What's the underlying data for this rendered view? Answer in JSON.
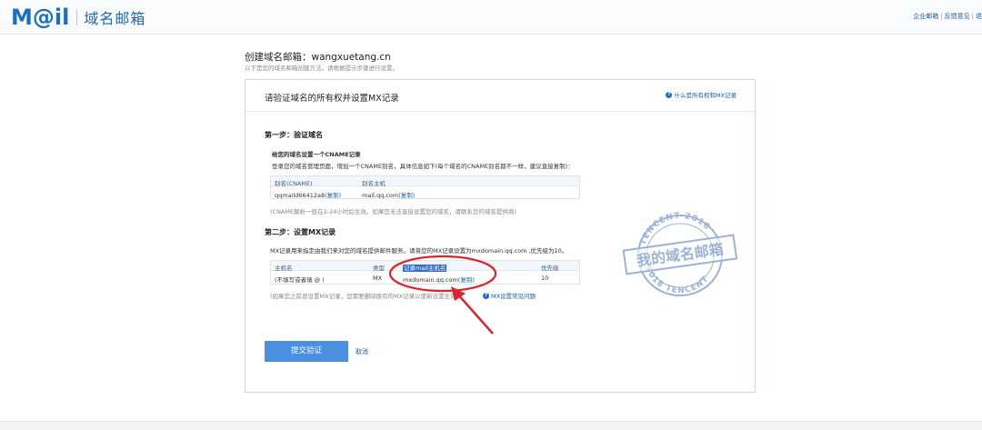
{
  "topbar": {
    "logo_mail": "M@il",
    "logo_text": "域名邮箱",
    "links": [
      "企业邮箱",
      "反馈意见",
      "退"
    ]
  },
  "header": {
    "title": "创建域名邮箱：wangxuetang.cn",
    "subtitle": "以下是您的域名邮箱创建方法。请根据提示步骤进行设置。"
  },
  "panel": {
    "title": "请验证域名的所有权并设置MX记录",
    "help_link": "什么是所有权和MX记录"
  },
  "step1": {
    "title": "第一步：验证域名",
    "subtitle": "给您的域名设置一个CNAME记录",
    "desc": "登录您的域名管理页面，增加一个CNAME别名，具体信息如下(每个域名的CNAME别名都不一样，建议直接复制)：",
    "table": {
      "headers": [
        "别名(CNAME)",
        "别名主机"
      ],
      "row": {
        "alias": "qqmaild66412a8",
        "host": "mail.qq.com"
      },
      "copy_label": "(复制)"
    },
    "note": "(CNAME解析一般在2-24小时后生效。如果您无法直接设置您的域名，请联系您的域名提供商)"
  },
  "step2": {
    "title": "第二步：设置MX记录",
    "desc": "MX记录用来指定由我们来对您的域名提供邮件服务。请将您的MX记录设置为mxdomain.qq.com ,优先级为10。",
    "table": {
      "headers": [
        "主机名",
        "类型",
        "记录mail主机名",
        "优先级"
      ],
      "row": {
        "host": "(不填写或者填 @ )",
        "type": "MX",
        "value": "mxdomain.qq.com",
        "priority": "10"
      },
      "copy_label": "(复制)"
    },
    "note": "(如果您之前曾设置MX记录，您需要删除原有的MX记录以使新设置生效)",
    "faq_link": "MX设置常见问题"
  },
  "actions": {
    "submit": "提交验证",
    "cancel": "取消"
  },
  "stamp": {
    "main": "我的域名邮箱",
    "ring_top": "TENCENT 2018",
    "ring_bottom": "2018 TENCENT"
  },
  "colors": {
    "brand": "#1a6fc4",
    "link": "#1a5fa8",
    "button": "#4a8fe0",
    "annotation": "#d9262c",
    "stamp": "#8aa6cf"
  }
}
